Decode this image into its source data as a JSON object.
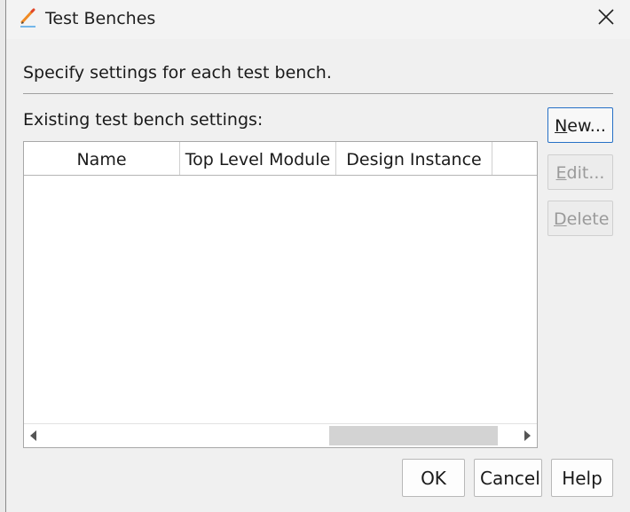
{
  "dialog": {
    "title": "Test Benches",
    "intro": "Specify settings for each test bench.",
    "existing_label": "Existing test bench settings:"
  },
  "table": {
    "columns": [
      "Name",
      "Top Level Module",
      "Design Instance",
      ""
    ],
    "rows": []
  },
  "side_buttons": {
    "new": {
      "mnemonic": "N",
      "rest": "ew..."
    },
    "edit": {
      "mnemonic": "E",
      "rest": "dit..."
    },
    "delete": {
      "mnemonic": "D",
      "rest": "elete"
    }
  },
  "footer_buttons": {
    "ok": "OK",
    "cancel": "Cancel",
    "help": "Help"
  },
  "icons": {
    "title": "edit-pencil-icon",
    "close": "close-icon",
    "scroll_left": "arrow-left-icon",
    "scroll_right": "arrow-right-icon"
  },
  "colors": {
    "dialog_bg": "#f0f0f0",
    "default_button_border": "#2670c6",
    "disabled_text": "#9a9a9a"
  },
  "state": {
    "edit_enabled": false,
    "delete_enabled": false,
    "default_button": "new"
  }
}
